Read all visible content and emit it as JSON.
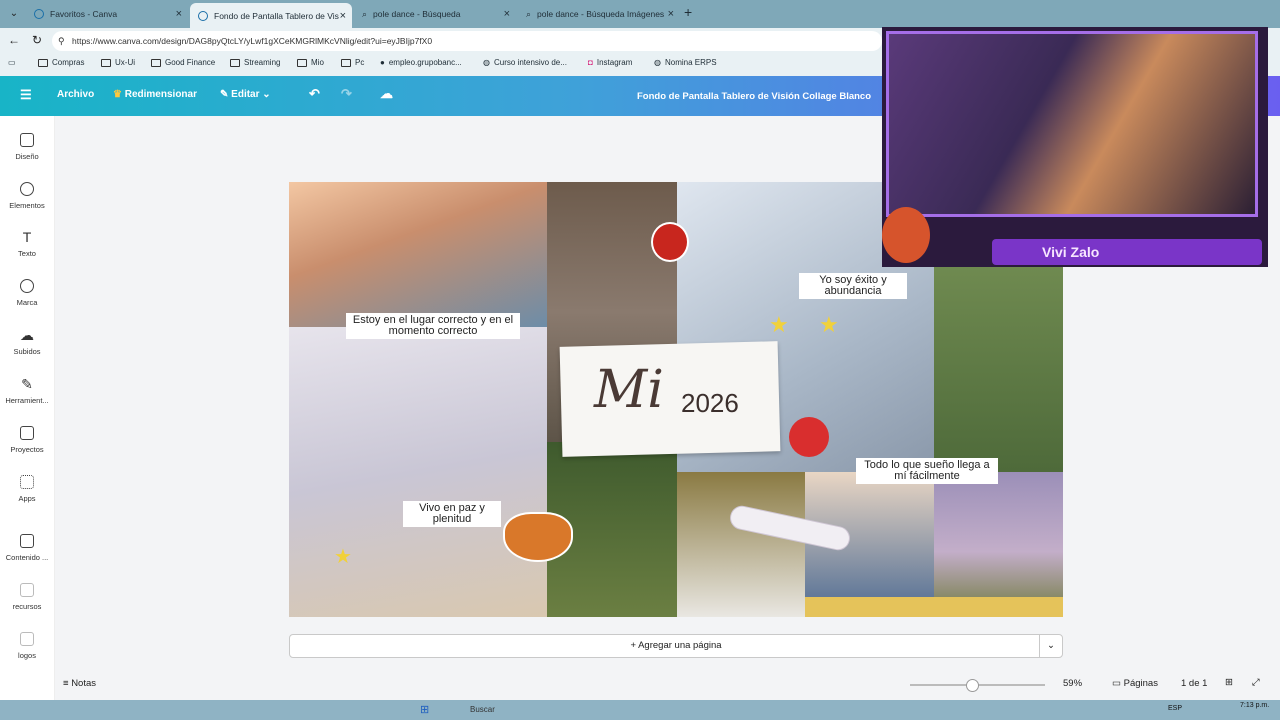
{
  "browser": {
    "tabs": [
      {
        "label": "Favoritos - Canva",
        "active": false
      },
      {
        "label": "Fondo de Pantalla Tablero de Visió",
        "active": true
      },
      {
        "label": "pole dance - Búsqueda",
        "active": false
      },
      {
        "label": "pole dance - Búsqueda Imágenes",
        "active": false
      }
    ],
    "url": "https://www.canva.com/design/DAG8pyQtcLY/yLwf1gXCeKMGRlMKcVNlig/edit?ui=eyJBIjp7fX0",
    "bookmarks": [
      "Compras",
      "Ux-Ui",
      "Good Finance",
      "Streaming",
      "Mio",
      "Pc",
      "empleo.grupobanc...",
      "Curso intensivo de...",
      "Instagram",
      "Nomina ERPS"
    ]
  },
  "canva": {
    "menu": {
      "file": "Archivo",
      "resize": "Redimensionar",
      "edit": "Editar"
    },
    "design_title": "Fondo de Pantalla Tablero de Visión Collage Blanco",
    "sidebar": [
      "Diseño",
      "Elementos",
      "Texto",
      "Marca",
      "Subidos",
      "Herramient...",
      "Proyectos",
      "Apps",
      "Contenido ...",
      "recursos",
      "logos"
    ],
    "collage": {
      "title_script": "Mi",
      "title_year": "2026",
      "captions": {
        "c1": "Estoy en el lugar correcto y en el momento correcto",
        "c2": "Yo soy éxito y abundancia",
        "c3": "Todo lo que sueño llega a mí fácilmente",
        "c4": "Vivo en paz y plenitud"
      }
    },
    "add_page": "+ Agregar una página",
    "bottom": {
      "notes": "Notas",
      "zoom": "59%",
      "pages_label": "Páginas",
      "page_count": "1 de 1"
    }
  },
  "stream_overlay": {
    "name": "Vivi Zalo"
  },
  "taskbar": {
    "search": "Buscar",
    "lang": "ESP",
    "time": "7:13 p.m."
  },
  "colors": {
    "canva_gradient_start": "#18b4c7",
    "canva_gradient_end": "#6a5ff0",
    "overlay_purple": "#7a35c8"
  }
}
